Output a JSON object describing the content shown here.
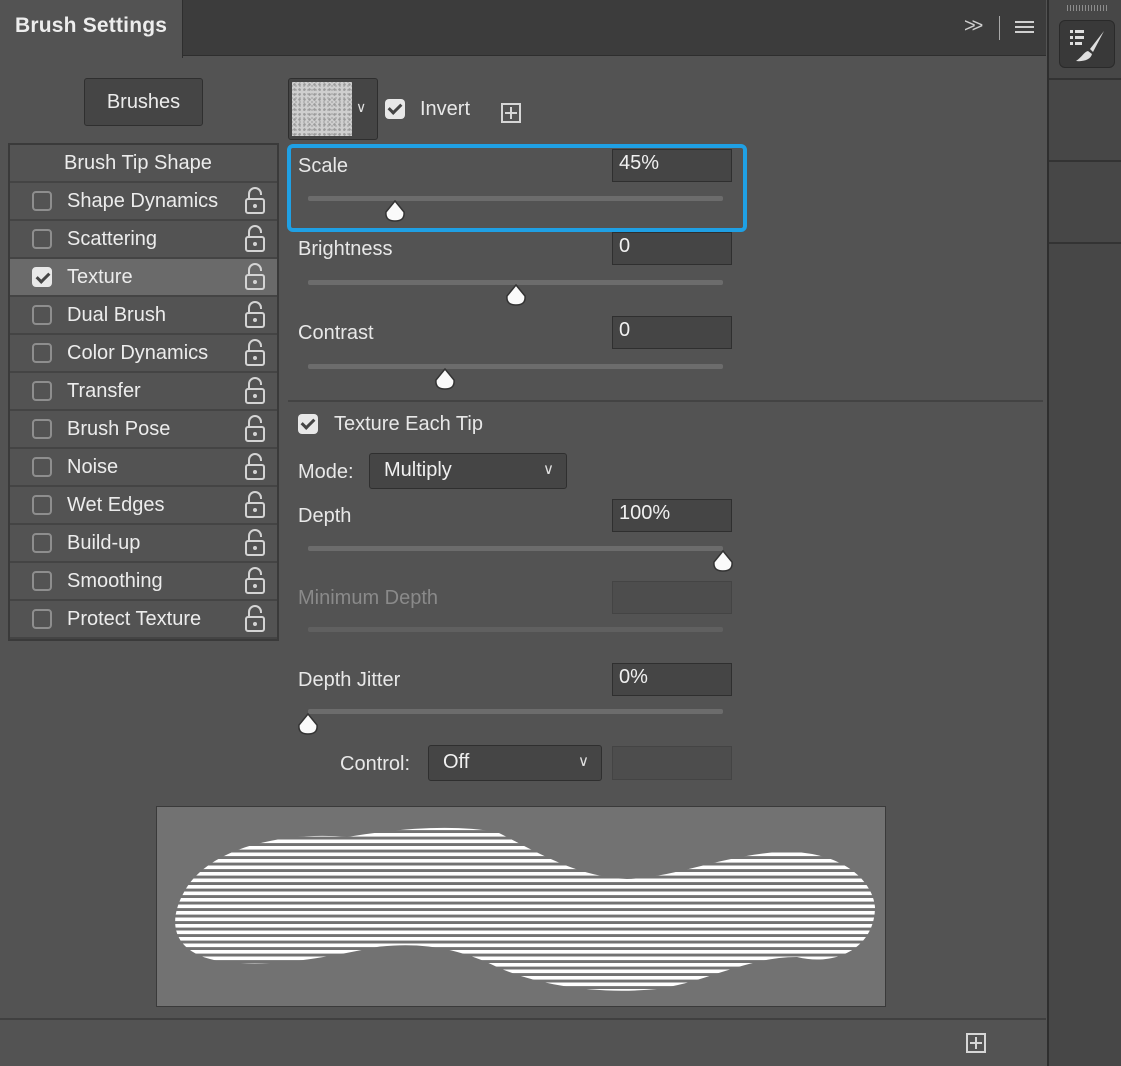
{
  "panel": {
    "title": "Brush Settings",
    "expand_icon": "double-chevron-right-icon",
    "menu_icon": "hamburger-menu-icon"
  },
  "dock": {
    "button_icon": "brush-settings-icon"
  },
  "brushes_button": "Brushes",
  "options_list": [
    {
      "label": "Brush Tip Shape",
      "header": true
    },
    {
      "label": "Shape Dynamics",
      "checked": false
    },
    {
      "label": "Scattering",
      "checked": false
    },
    {
      "label": "Texture",
      "checked": true,
      "selected": true
    },
    {
      "label": "Dual Brush",
      "checked": false
    },
    {
      "label": "Color Dynamics",
      "checked": false
    },
    {
      "label": "Transfer",
      "checked": false
    },
    {
      "label": "Brush Pose",
      "checked": false
    },
    {
      "label": "Noise",
      "checked": false
    },
    {
      "label": "Wet Edges",
      "checked": false
    },
    {
      "label": "Build-up",
      "checked": false
    },
    {
      "label": "Smoothing",
      "checked": false
    },
    {
      "label": "Protect Texture",
      "checked": false
    }
  ],
  "texture": {
    "invert_label": "Invert",
    "invert_checked": true,
    "scale": {
      "label": "Scale",
      "value": "45%",
      "level": 0.21
    },
    "brightness": {
      "label": "Brightness",
      "value": "0",
      "level": 0.5
    },
    "contrast": {
      "label": "Contrast",
      "value": "0",
      "level": 0.33
    },
    "texture_each_tip": {
      "label": "Texture Each Tip",
      "checked": true
    },
    "mode": {
      "label": "Mode:",
      "value": "Multiply"
    },
    "depth": {
      "label": "Depth",
      "value": "100%",
      "level": 1.0
    },
    "minimum_depth": {
      "label": "Minimum Depth",
      "value": ""
    },
    "depth_jitter": {
      "label": "Depth Jitter",
      "value": "0%",
      "level": 0.0
    },
    "control": {
      "label": "Control:",
      "value": "Off",
      "extra": ""
    }
  },
  "colors": {
    "highlight": "#1fa0e4",
    "panel": "#535353"
  }
}
